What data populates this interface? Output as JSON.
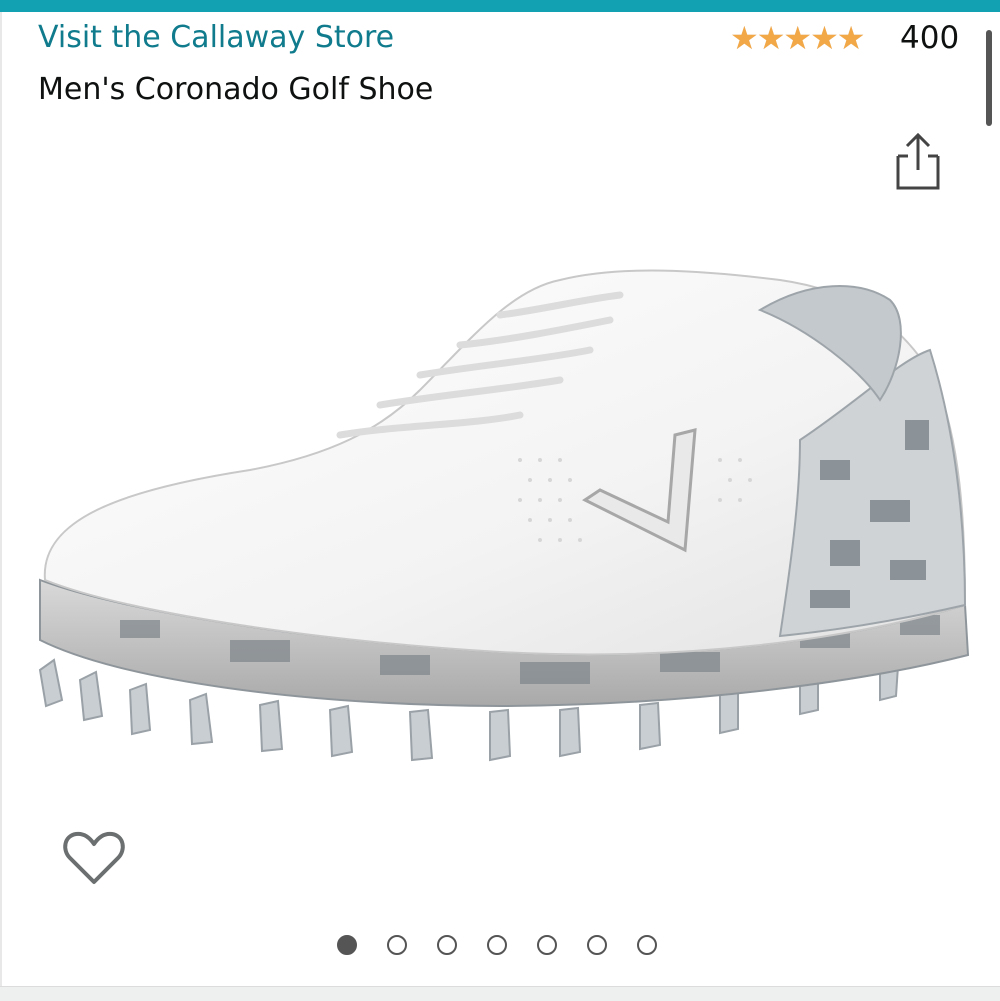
{
  "header": {
    "store_link": "Visit the Callaway Store",
    "product_title": "Men's Coronado Golf Shoe"
  },
  "rating": {
    "stars": 4.5,
    "out_of": 5,
    "review_count": "400",
    "star_glyphs": "★★★★★",
    "star_color": "#f3a847"
  },
  "actions": {
    "share_icon": "share-icon",
    "wishlist_icon": "heart-icon"
  },
  "product_image": {
    "subject": "golf-shoe"
  },
  "carousel": {
    "total": 7,
    "active_index": 0
  },
  "colors": {
    "accent_bar": "#12a1b3",
    "link": "#0f7b8c"
  }
}
